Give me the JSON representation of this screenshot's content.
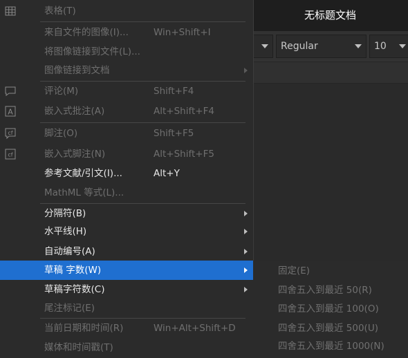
{
  "document": {
    "title": "无标题文档"
  },
  "toolbar": {
    "font_style": "Regular",
    "font_size": "10"
  },
  "menu": {
    "items": [
      {
        "label": "表格(T)",
        "shortcut": "",
        "submenu": false,
        "enabled": false,
        "icon": "table-icon"
      },
      {
        "label": "来自文件的图像(I)...",
        "shortcut": "Win+Shift+I",
        "submenu": false,
        "enabled": false,
        "icon": ""
      },
      {
        "label": "将图像链接到文件(L)...",
        "shortcut": "",
        "submenu": false,
        "enabled": false,
        "icon": ""
      },
      {
        "label": "图像链接到文档",
        "shortcut": "",
        "submenu": true,
        "enabled": false,
        "icon": ""
      },
      {
        "label": "评论(M)",
        "shortcut": "Shift+F4",
        "submenu": false,
        "enabled": false,
        "icon": "comment-icon"
      },
      {
        "label": "嵌入式批注(A)",
        "shortcut": "Alt+Shift+F4",
        "submenu": false,
        "enabled": false,
        "icon": "inline-annotation-icon"
      },
      {
        "label": "脚注(O)",
        "shortcut": "Shift+F5",
        "submenu": false,
        "enabled": false,
        "icon": "footnote-icon"
      },
      {
        "label": "嵌入式脚注(N)",
        "shortcut": "Alt+Shift+F5",
        "submenu": false,
        "enabled": false,
        "icon": "inline-footnote-icon"
      },
      {
        "label": "参考文献/引文(I)...",
        "shortcut": "Alt+Y",
        "submenu": false,
        "enabled": true,
        "icon": ""
      },
      {
        "label": "MathML 等式(L)...",
        "shortcut": "",
        "submenu": false,
        "enabled": false,
        "icon": ""
      },
      {
        "label": "分隔符(B)",
        "shortcut": "",
        "submenu": true,
        "enabled": true,
        "icon": ""
      },
      {
        "label": "水平线(H)",
        "shortcut": "",
        "submenu": true,
        "enabled": true,
        "icon": ""
      },
      {
        "label": "自动编号(A)",
        "shortcut": "",
        "submenu": true,
        "enabled": true,
        "icon": ""
      },
      {
        "label": "草稿 字数(W)",
        "shortcut": "",
        "submenu": true,
        "enabled": true,
        "icon": "",
        "highlighted": true
      },
      {
        "label": "草稿字符数(C)",
        "shortcut": "",
        "submenu": true,
        "enabled": true,
        "icon": ""
      },
      {
        "label": "尾注标记(E)",
        "shortcut": "",
        "submenu": false,
        "enabled": false,
        "icon": ""
      },
      {
        "label": "当前日期和时间(R)",
        "shortcut": "Win+Alt+Shift+D",
        "submenu": false,
        "enabled": false,
        "icon": ""
      },
      {
        "label": "媒体和时间戳(T)",
        "shortcut": "",
        "submenu": false,
        "enabled": false,
        "icon": ""
      }
    ]
  },
  "submenu": {
    "items": [
      {
        "label": "固定(E)"
      },
      {
        "label": "四舍五入到最近 50(R)"
      },
      {
        "label": "四舍五入到最近 100(O)"
      },
      {
        "label": "四舍五入到最近 500(U)"
      },
      {
        "label": "四舍五入到最近 1000(N)"
      }
    ]
  },
  "colors": {
    "highlight": "#1f6fd0",
    "menu_bg": "#2b2b2b",
    "disabled_text": "#6f6f6f",
    "enabled_text": "#e8e8e8"
  }
}
